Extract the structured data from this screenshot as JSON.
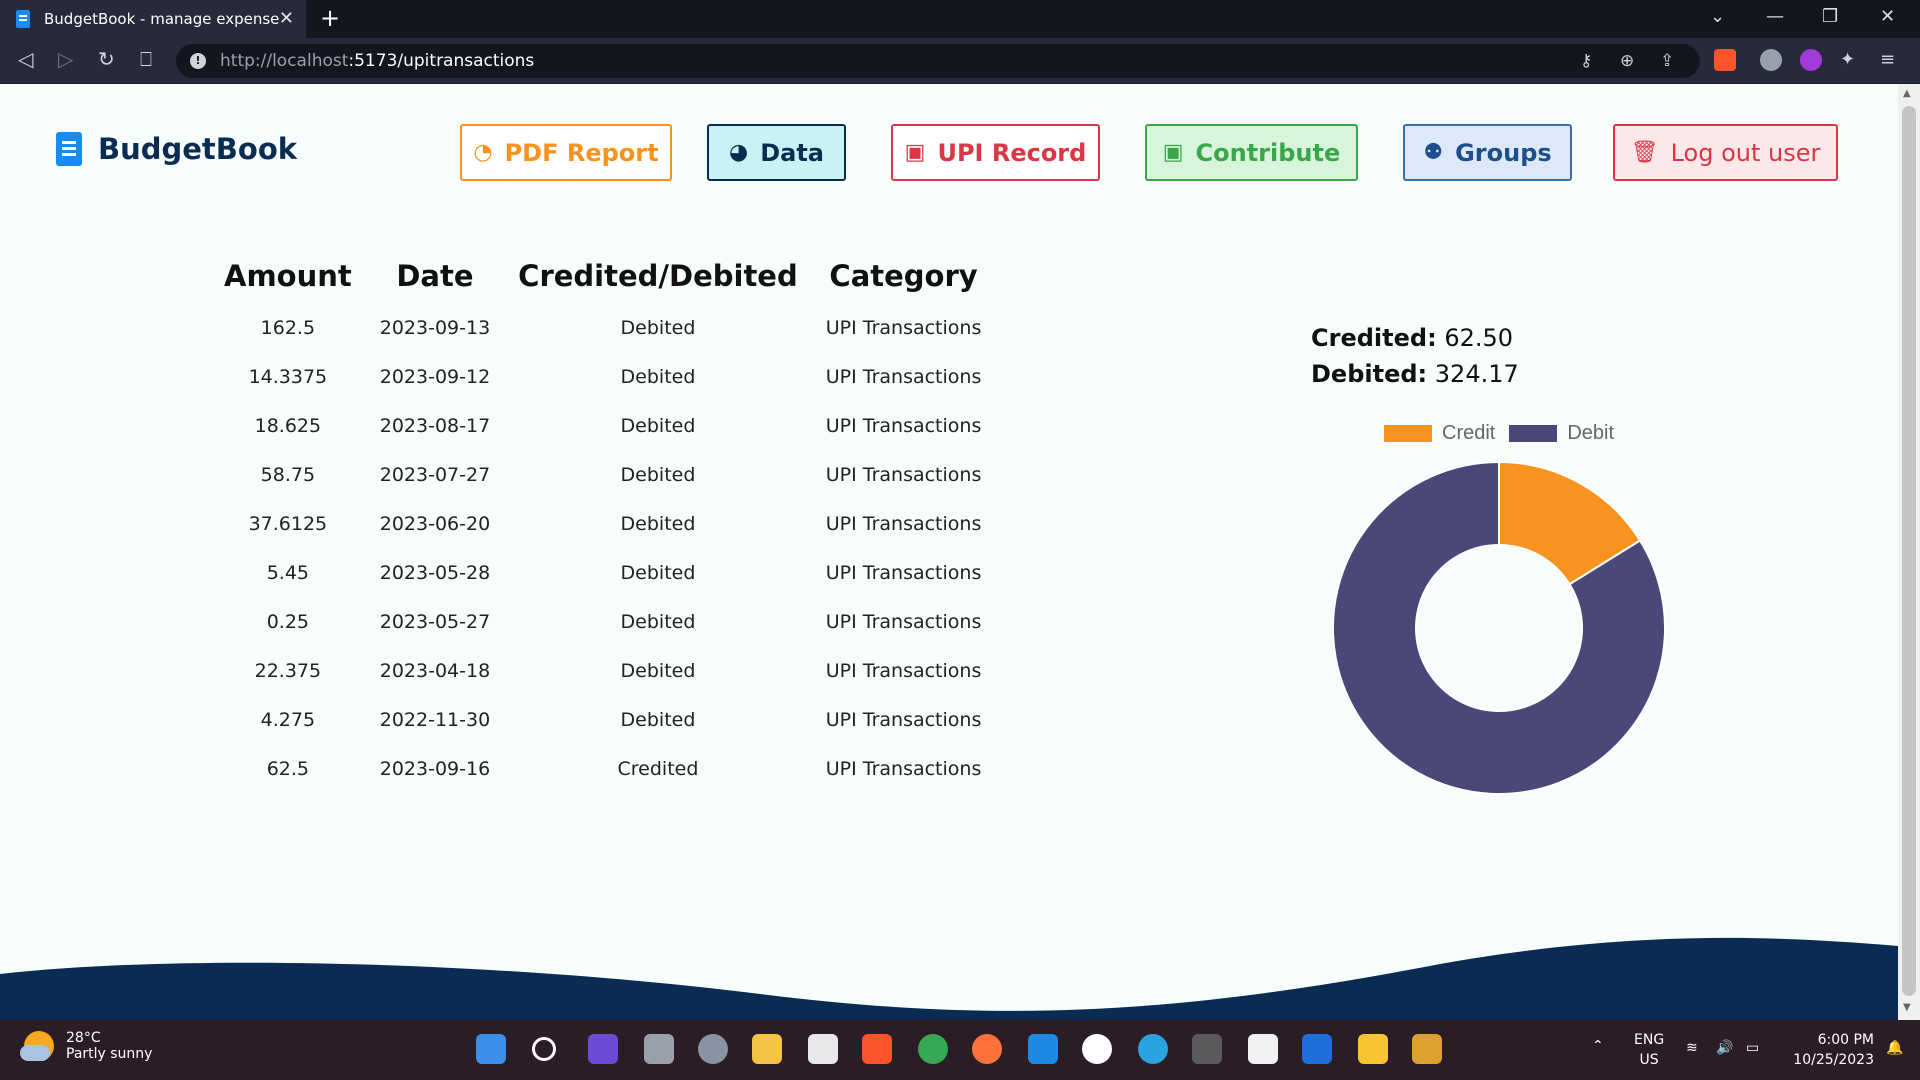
{
  "browser": {
    "tab_title": "BudgetBook - manage expenses",
    "tab_close": "✕",
    "new_tab": "+",
    "url_host": "http://localhost",
    "url_rest": ":5173/upitransactions"
  },
  "app": {
    "brand": "BudgetBook",
    "nav": {
      "pdf": "PDF Report",
      "data": "Data",
      "upi": "UPI Record",
      "contribute": "Contribute",
      "groups": "Groups",
      "logout": "Log out user"
    }
  },
  "table": {
    "headers": [
      "Amount",
      "Date",
      "Credited/Debited",
      "Category"
    ],
    "rows": [
      [
        "162.5",
        "2023-09-13",
        "Debited",
        "UPI Transactions"
      ],
      [
        "14.3375",
        "2023-09-12",
        "Debited",
        "UPI Transactions"
      ],
      [
        "18.625",
        "2023-08-17",
        "Debited",
        "UPI Transactions"
      ],
      [
        "58.75",
        "2023-07-27",
        "Debited",
        "UPI Transactions"
      ],
      [
        "37.6125",
        "2023-06-20",
        "Debited",
        "UPI Transactions"
      ],
      [
        "5.45",
        "2023-05-28",
        "Debited",
        "UPI Transactions"
      ],
      [
        "0.25",
        "2023-05-27",
        "Debited",
        "UPI Transactions"
      ],
      [
        "22.375",
        "2023-04-18",
        "Debited",
        "UPI Transactions"
      ],
      [
        "4.275",
        "2022-11-30",
        "Debited",
        "UPI Transactions"
      ],
      [
        "62.5",
        "2023-09-16",
        "Credited",
        "UPI Transactions"
      ]
    ]
  },
  "totals": {
    "credited_label": "Credited:",
    "credited_value": "62.50",
    "debited_label": "Debited:",
    "debited_value": "324.17"
  },
  "chart_data": {
    "type": "pie",
    "categories": [
      "Credit",
      "Debit"
    ],
    "values": [
      62.5,
      324.17
    ],
    "colors": [
      "#f7931e",
      "#4a4878"
    ],
    "legend": "top"
  },
  "taskbar": {
    "temp": "28°C",
    "weather": "Partly sunny",
    "lang1": "ENG",
    "lang2": "US",
    "time": "6:00 PM",
    "date": "10/25/2023"
  },
  "colors": {
    "navy": "#0b2c52",
    "orange": "#f7931e",
    "red": "#dc3545",
    "green": "#3aa64a",
    "debit": "#4a4878"
  }
}
